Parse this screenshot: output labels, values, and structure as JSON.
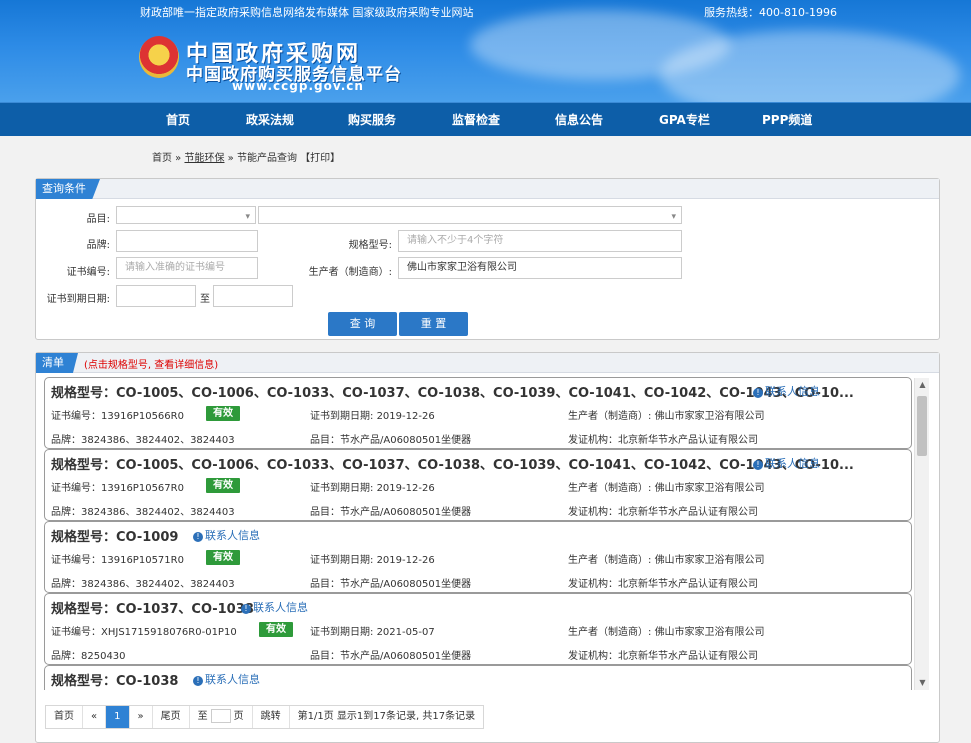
{
  "header": {
    "topline": "财政部唯一指定政府采购信息网络发布媒体 国家级政府采购专业网站",
    "hotline": "服务热线：400-810-1996",
    "logo_line1": "中国政府采购网",
    "logo_line2": "中国政府购买服务信息平台",
    "logo_url": "www.ccgp.gov.cn"
  },
  "nav": [
    "首页",
    "政采法规",
    "购买服务",
    "监督检查",
    "信息公告",
    "GPA专栏",
    "PPP频道"
  ],
  "breadcrumb": {
    "home": "首页",
    "sep1": " » ",
    "section": "节能环保",
    "sep2": " » ",
    "page": "节能产品查询",
    "print": "【打印】"
  },
  "query": {
    "tab": "查询条件",
    "labels": {
      "category": "品目:",
      "brand": "品牌:",
      "model": "规格型号:",
      "cert_no": "证书编号:",
      "maker": "生产者（制造商）:",
      "expiry": "证书到期日期:",
      "to": "至"
    },
    "model_placeholder": "请输入不少于4个字符",
    "cert_placeholder": "请输入准确的证书编号",
    "maker_value": "佛山市家家卫浴有限公司",
    "search_btn": "查 询",
    "reset_btn": "重 置"
  },
  "list": {
    "tab": "清单",
    "note": "(点击规格型号, 查看详细信息)",
    "contact_label": "联系人信息",
    "labels": {
      "cert_no": "证书编号：",
      "expiry": "证书到期日期: ",
      "maker": "生产者（制造商）: ",
      "brand": "品牌：",
      "category": "品目：",
      "issuer": "发证机构："
    },
    "items": [
      {
        "title": "规格型号：CO-1005、CO-1006、CO-1033、CO-1037、CO-1038、CO-1039、CO-1041、CO-1042、CO-1043、CO-10...",
        "cert_no": "13916P10566R0",
        "status": "有效",
        "expiry": "2019-12-26",
        "maker": "佛山市家家卫浴有限公司",
        "brand": "3824386、3824402、3824403",
        "category": "节水产品/A06080501坐便器",
        "issuer": "北京新华节水产品认证有限公司"
      },
      {
        "title": "规格型号：CO-1005、CO-1006、CO-1033、CO-1037、CO-1038、CO-1039、CO-1041、CO-1042、CO-1043、CO-10...",
        "cert_no": "13916P10567R0",
        "status": "有效",
        "expiry": "2019-12-26",
        "maker": "佛山市家家卫浴有限公司",
        "brand": "3824386、3824402、3824403",
        "category": "节水产品/A06080501坐便器",
        "issuer": "北京新华节水产品认证有限公司"
      },
      {
        "title": "规格型号：CO-1009",
        "cert_no": "13916P10571R0",
        "status": "有效",
        "expiry": "2019-12-26",
        "maker": "佛山市家家卫浴有限公司",
        "brand": "3824386、3824402、3824403",
        "category": "节水产品/A06080501坐便器",
        "issuer": "北京新华节水产品认证有限公司"
      },
      {
        "title": "规格型号：CO-1037、CO-1038",
        "cert_no": "XHJS1715918076R0-01P10",
        "status": "有效",
        "expiry": "2021-05-07",
        "maker": "佛山市家家卫浴有限公司",
        "brand": "8250430",
        "category": "节水产品/A06080501坐便器",
        "issuer": "北京新华节水产品认证有限公司"
      },
      {
        "title": "规格型号：CO-1038"
      }
    ]
  },
  "pager": {
    "first": "首页",
    "prev": "«",
    "current": "1",
    "next": "»",
    "last": "尾页",
    "goto_prefix": "至",
    "goto_suffix": "页",
    "jump": "跳转",
    "summary": "第1/1页  显示1到17条记录, 共17条记录"
  }
}
